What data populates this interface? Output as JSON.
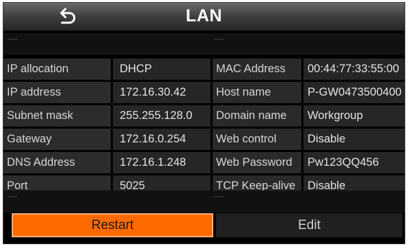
{
  "header": {
    "title": "LAN",
    "back_icon": "back-arrow-icon"
  },
  "rows": [
    {
      "label": "IP allocation",
      "value": "DHCP",
      "label2": "MAC Address",
      "value2": "00:44:77:33:55:00"
    },
    {
      "label": "IP address",
      "value": "172.16.30.42",
      "label2": "Host name",
      "value2": "P-GW0473500400"
    },
    {
      "label": "Subnet mask",
      "value": "255.255.128.0",
      "label2": "Domain name",
      "value2": "Workgroup"
    },
    {
      "label": "Gateway",
      "value": "172.16.0.254",
      "label2": "Web control",
      "value2": "Disable"
    },
    {
      "label": "DNS Address",
      "value": "172.16.1.248",
      "label2": "Web Password",
      "value2": "Pw123QQ456"
    },
    {
      "label": "Port",
      "value": "5025",
      "label2": "TCP Keep-alive",
      "value2": "Disable"
    }
  ],
  "buttons": {
    "restart": "Restart",
    "edit": "Edit"
  },
  "colors": {
    "accent": "#ff6a00",
    "background": "#000000"
  }
}
